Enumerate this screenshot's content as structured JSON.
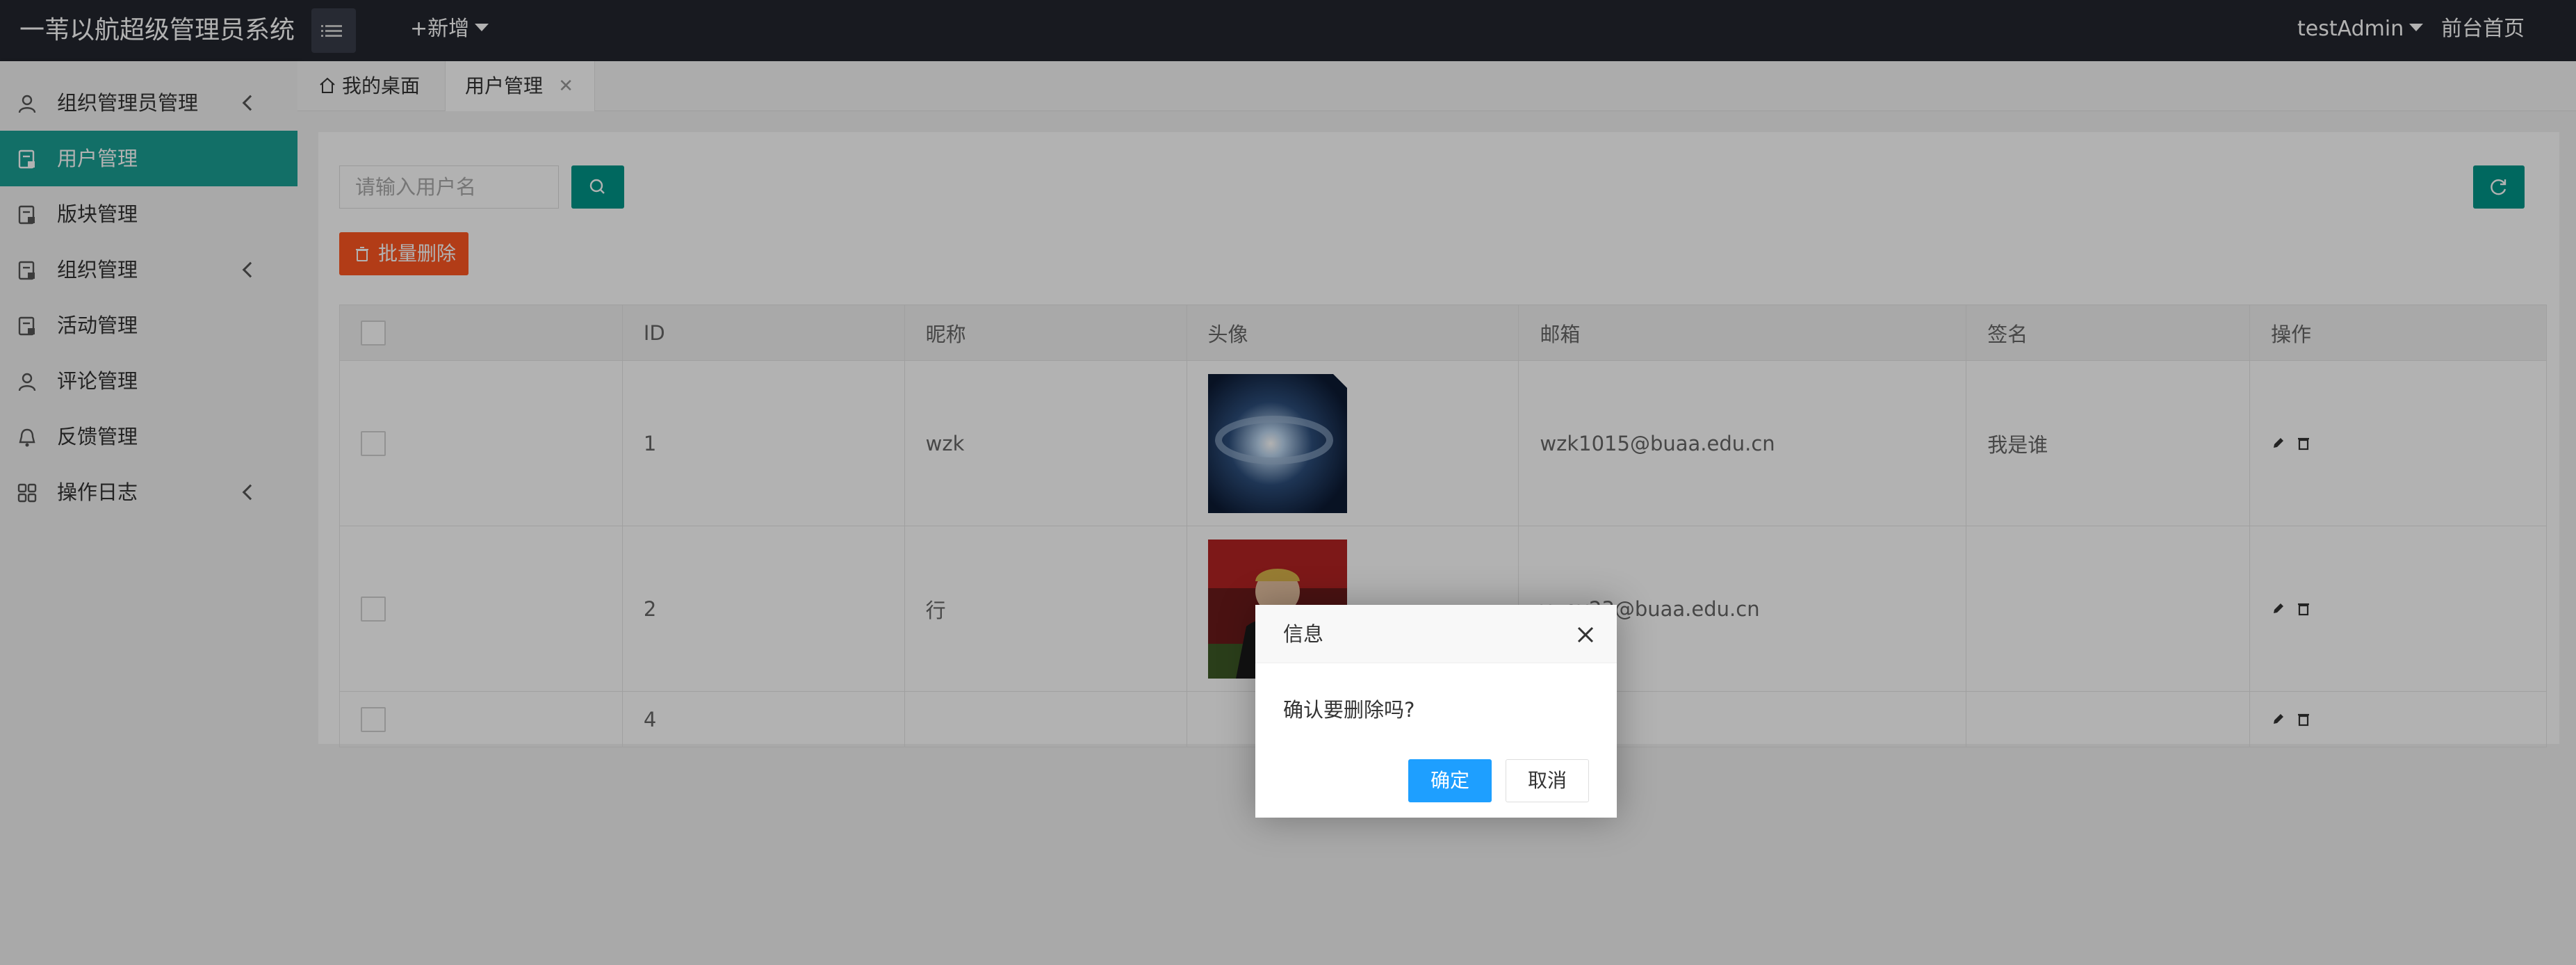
{
  "app": {
    "brand": "一苇以航超级管理员系统",
    "add_new": "+新增",
    "user": "testAdmin",
    "front_home": "前台首页"
  },
  "sidebar": {
    "items": [
      {
        "label": "组织管理员管理",
        "icon": "user-icon",
        "has_children": true
      },
      {
        "label": "用户管理",
        "icon": "doc-icon",
        "active": true
      },
      {
        "label": "版块管理",
        "icon": "doc-icon"
      },
      {
        "label": "组织管理",
        "icon": "doc-icon",
        "has_children": true
      },
      {
        "label": "活动管理",
        "icon": "doc-icon"
      },
      {
        "label": "评论管理",
        "icon": "user-icon"
      },
      {
        "label": "反馈管理",
        "icon": "bell-icon"
      },
      {
        "label": "操作日志",
        "icon": "grid-icon",
        "has_children": true
      }
    ]
  },
  "tabs": {
    "desktop": "我的桌面",
    "current": "用户管理"
  },
  "toolbar": {
    "search_placeholder": "请输入用户名",
    "batch_delete": "批量删除"
  },
  "table": {
    "headers": [
      "",
      "ID",
      "昵称",
      "头像",
      "邮箱",
      "签名",
      "操作"
    ],
    "rows": [
      {
        "id": "1",
        "nickname": "wzk",
        "avatar": "night-sky-avatar",
        "email": "wzk1015@buaa.edu.cn",
        "signature": "我是谁"
      },
      {
        "id": "2",
        "nickname": "行",
        "avatar": "football-player-avatar",
        "email": "yuey23@buaa.edu.cn",
        "signature": ""
      },
      {
        "id": "4",
        "nickname": "",
        "avatar": "",
        "email": "",
        "signature": ""
      }
    ]
  },
  "dialog": {
    "title": "信息",
    "message": "确认要删除吗?",
    "ok": "确定",
    "cancel": "取消"
  },
  "colors": {
    "topbar": "#23262e",
    "accent": "#009688",
    "active": "#1aa094",
    "danger": "#ff5722",
    "primary": "#1e9fff"
  }
}
